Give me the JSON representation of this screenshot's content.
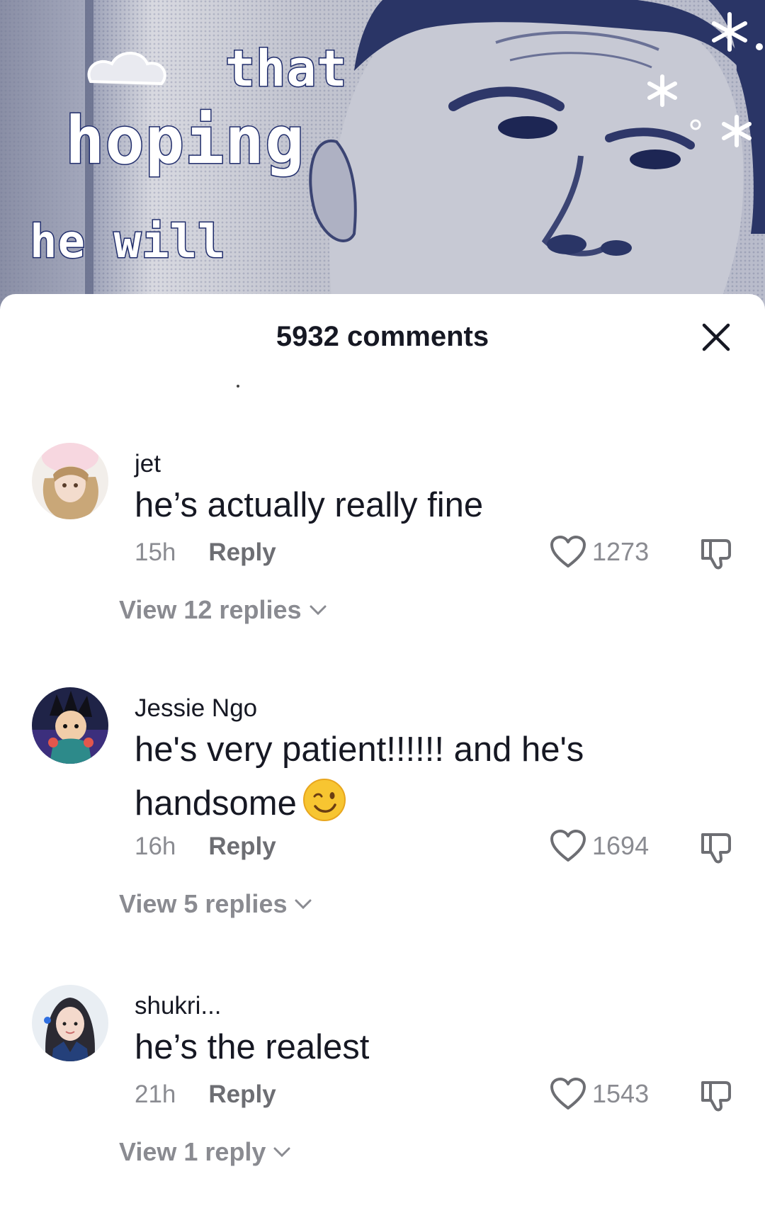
{
  "video": {
    "sticker_top": "that",
    "sticker_middle": "hoping",
    "sticker_bottom": "he will"
  },
  "sheet": {
    "title": "5932 comments",
    "close_icon": "close-icon"
  },
  "comments": [
    {
      "username": "jet",
      "text": "he’s actually really fine",
      "time": "15h",
      "reply_label": "Reply",
      "likes": "1273",
      "view_replies": "View 12 replies"
    },
    {
      "username": "Jessie Ngo",
      "text": "he's very patient!!!!!! and he's handsome",
      "emoji": "winking-face",
      "time": "16h",
      "reply_label": "Reply",
      "likes": "1694",
      "view_replies": "View 5 replies"
    },
    {
      "username": "shukri...",
      "text": "he’s the realest",
      "time": "21h",
      "reply_label": "Reply",
      "likes": "1543",
      "view_replies": "View 1 reply"
    }
  ],
  "icons": {
    "like": "heart-outline-icon",
    "dislike": "thumbs-down-icon",
    "expand": "chevron-down-icon"
  },
  "colors": {
    "text_primary": "#161823",
    "text_secondary": "#8a8b91",
    "sticker_outline": "#1f2c6b"
  }
}
